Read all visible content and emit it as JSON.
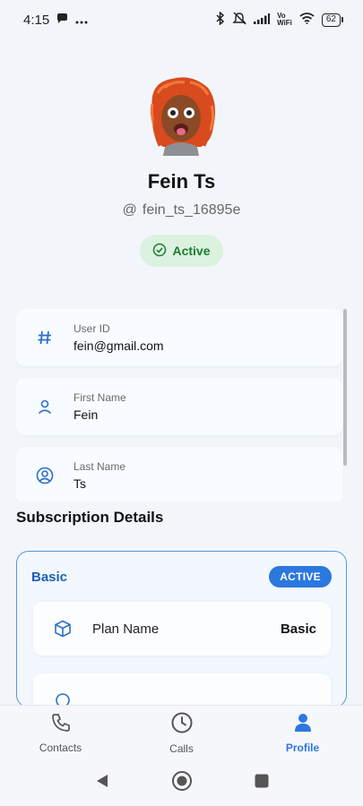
{
  "status_bar": {
    "time": "4:15",
    "battery": "62"
  },
  "profile": {
    "name": "Fein Ts",
    "username": "fein_ts_16895e",
    "at_symbol": "@",
    "status": "Active"
  },
  "info_cards": [
    {
      "label": "User ID",
      "value": "fein@gmail.com",
      "icon": "hash-icon"
    },
    {
      "label": "First Name",
      "value": "Fein",
      "icon": "person-icon"
    },
    {
      "label": "Last Name",
      "value": "Ts",
      "icon": "person-circle-icon"
    }
  ],
  "subscription": {
    "section_title": "Subscription Details",
    "plan_title": "Basic",
    "badge": "ACTIVE",
    "rows": [
      {
        "label": "Plan Name",
        "value": "Basic",
        "icon": "cube-icon"
      }
    ]
  },
  "nav": {
    "items": [
      {
        "label": "Contacts",
        "icon": "phone-icon"
      },
      {
        "label": "Calls",
        "icon": "clock-icon"
      },
      {
        "label": "Profile",
        "icon": "person-icon"
      }
    ],
    "active": "Profile"
  },
  "colors": {
    "accent": "#2b78de",
    "active_green": "#1f7a33",
    "active_pill_bg": "#daf2df"
  }
}
